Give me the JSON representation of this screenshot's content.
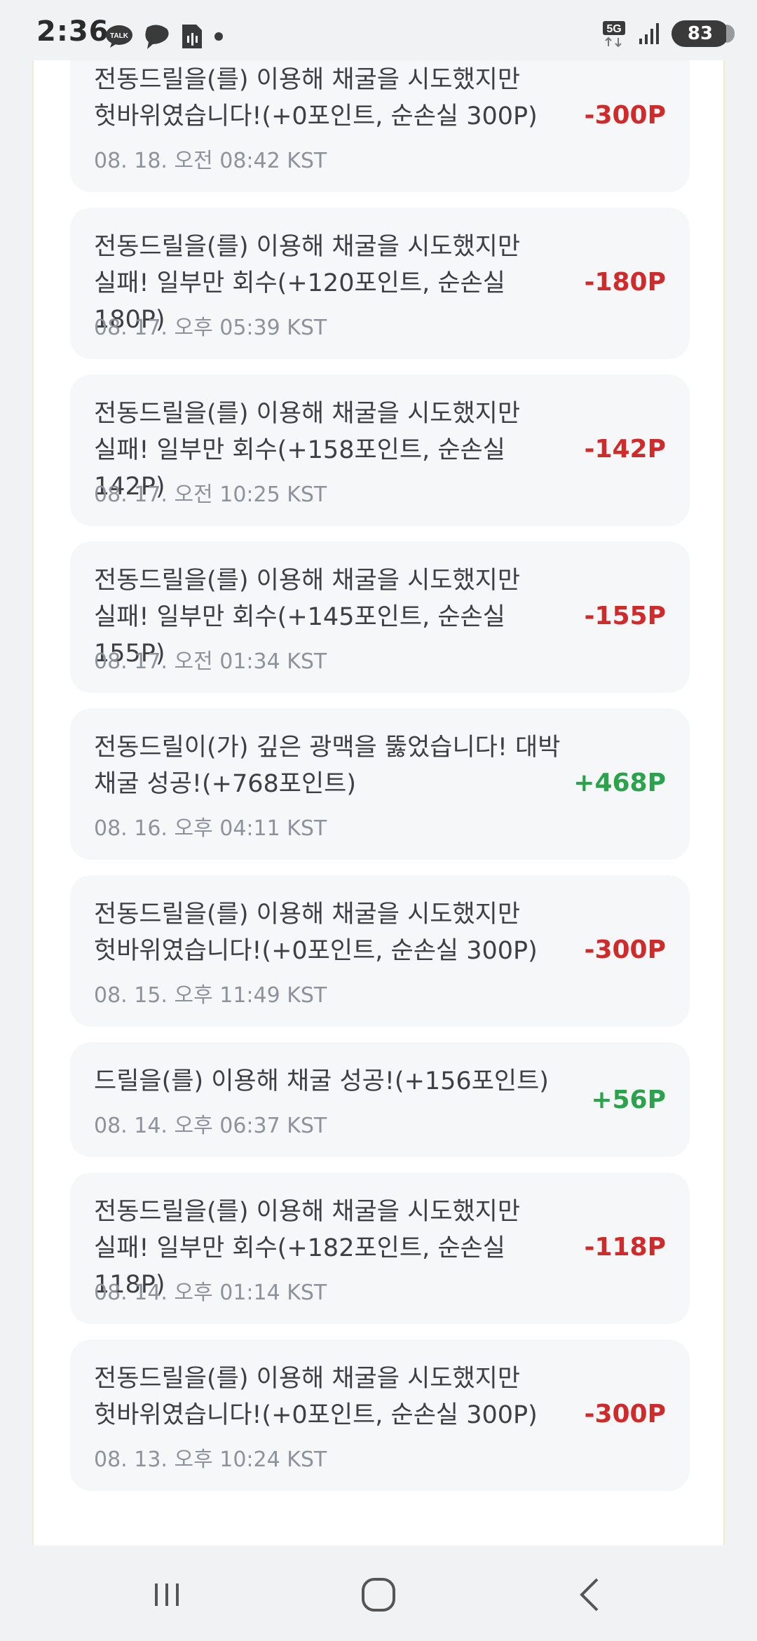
{
  "status_bar": {
    "time": "2:36",
    "notification_icons": [
      "kakaotalk-icon",
      "thread-icon",
      "voice-recorder-icon",
      "dot-icon"
    ],
    "network_label": "5G",
    "battery_level": "83"
  },
  "history": {
    "items": [
      {
        "text": "전동드릴을(를) 이용해 채굴을 시도했지만 헛바위였습니다!(+0포인트, 순손실 300P)",
        "time": "08. 18. 오전 08:42 KST",
        "amount": "-300P",
        "type": "negative"
      },
      {
        "text": "전동드릴을(를) 이용해 채굴을 시도했지만 실패! 일부만 회수(+120포인트, 순손실 180P)",
        "time": "08. 17. 오후 05:39 KST",
        "amount": "-180P",
        "type": "negative"
      },
      {
        "text": "전동드릴을(를) 이용해 채굴을 시도했지만 실패! 일부만 회수(+158포인트, 순손실 142P)",
        "time": "08. 17. 오전 10:25 KST",
        "amount": "-142P",
        "type": "negative"
      },
      {
        "text": "전동드릴을(를) 이용해 채굴을 시도했지만 실패! 일부만 회수(+145포인트, 순손실 155P)",
        "time": "08. 17. 오전 01:34 KST",
        "amount": "-155P",
        "type": "negative"
      },
      {
        "text": "전동드릴이(가) 깊은 광맥을 뚫었습니다! 대박 채굴 성공!(+768포인트)",
        "time": "08. 16. 오후 04:11 KST",
        "amount": "+468P",
        "type": "positive"
      },
      {
        "text": "전동드릴을(를) 이용해 채굴을 시도했지만 헛바위였습니다!(+0포인트, 순손실 300P)",
        "time": "08. 15. 오후 11:49 KST",
        "amount": "-300P",
        "type": "negative"
      },
      {
        "text": "드릴을(를) 이용해 채굴 성공!(+156포인트)",
        "time": "08. 14. 오후 06:37 KST",
        "amount": "+56P",
        "type": "positive"
      },
      {
        "text": "전동드릴을(를) 이용해 채굴을 시도했지만 실패! 일부만 회수(+182포인트, 순손실 118P)",
        "time": "08. 14. 오후 01:14 KST",
        "amount": "-118P",
        "type": "negative"
      },
      {
        "text": "전동드릴을(를) 이용해 채굴을 시도했지만 헛바위였습니다!(+0포인트, 순손실 300P)",
        "time": "08. 13. 오후 10:24 KST",
        "amount": "-300P",
        "type": "negative"
      }
    ]
  },
  "nav_bar": {
    "buttons": [
      "recent-apps-icon",
      "home-icon",
      "back-icon"
    ]
  },
  "colors": {
    "negative": "#cf2b2b",
    "positive": "#2ba24c"
  }
}
